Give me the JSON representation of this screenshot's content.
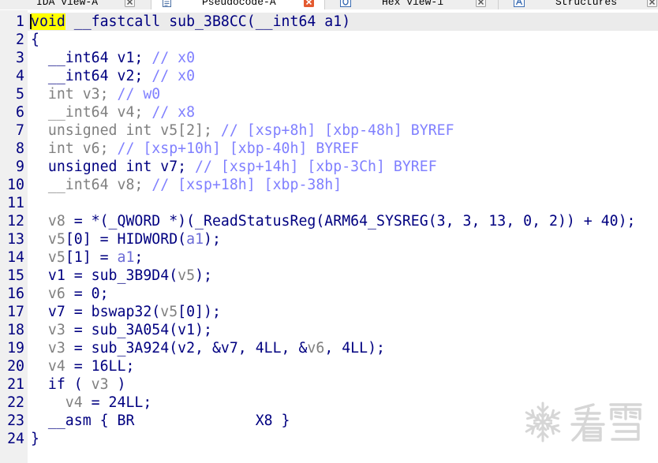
{
  "tabs": [
    {
      "label": "IDA View-A",
      "active": false
    },
    {
      "label": "Pseudocode-A",
      "active": true,
      "icon": "pseudocode-icon"
    },
    {
      "label": "Hex View-1",
      "active": false,
      "icon": "hex-view-icon"
    },
    {
      "label": "Structures",
      "active": false,
      "icon": "structures-icon"
    }
  ],
  "theme": {
    "close_active": "#e45a30"
  },
  "editor": {
    "colors": {
      "text": "#000080",
      "line_number": "#000080",
      "gutter_bg": "#f0f0f0",
      "current_line_bg": "#ebebeb"
    },
    "lines": [
      {
        "num": 1,
        "current": true,
        "tokens": [
          {
            "text": "void",
            "color": "#000080",
            "highlight": "#ffff00"
          },
          {
            "text": " __fastcall sub_3B8CC(__int64 a1)",
            "color": "#000080"
          }
        ]
      },
      {
        "num": 2,
        "tokens": [
          {
            "text": "{",
            "color": "#000080"
          }
        ]
      },
      {
        "num": 3,
        "tokens": [
          {
            "text": "  __int64 v1; ",
            "color": "#000080"
          },
          {
            "text": "// x0",
            "color": "#8080ff"
          }
        ]
      },
      {
        "num": 4,
        "tokens": [
          {
            "text": "  __int64 v2; ",
            "color": "#000080"
          },
          {
            "text": "// x0",
            "color": "#8080ff"
          }
        ]
      },
      {
        "num": 5,
        "tokens": [
          {
            "text": "  int v3; ",
            "color": "#808080"
          },
          {
            "text": "// w0",
            "color": "#8080ff"
          }
        ]
      },
      {
        "num": 6,
        "tokens": [
          {
            "text": "  __int64 v4; ",
            "color": "#808080"
          },
          {
            "text": "// x8",
            "color": "#8080ff"
          }
        ]
      },
      {
        "num": 7,
        "tokens": [
          {
            "text": "  unsigned int v5[2]; ",
            "color": "#808080"
          },
          {
            "text": "// [xsp+8h] [xbp-48h] BYREF",
            "color": "#8080ff"
          }
        ]
      },
      {
        "num": 8,
        "tokens": [
          {
            "text": "  int v6; ",
            "color": "#808080"
          },
          {
            "text": "// [xsp+10h] [xbp-40h] BYREF",
            "color": "#8080ff"
          }
        ]
      },
      {
        "num": 9,
        "tokens": [
          {
            "text": "  unsigned int v7; ",
            "color": "#000080"
          },
          {
            "text": "// [xsp+14h] [xbp-3Ch] BYREF",
            "color": "#8080ff"
          }
        ]
      },
      {
        "num": 10,
        "tokens": [
          {
            "text": "  __int64 v8; ",
            "color": "#808080"
          },
          {
            "text": "// [xsp+18h] [xbp-38h]",
            "color": "#8080ff"
          }
        ]
      },
      {
        "num": 11,
        "tokens": []
      },
      {
        "num": 12,
        "tokens": [
          {
            "text": "  v8",
            "color": "#808080"
          },
          {
            "text": " = *(_QWORD *)(_ReadStatusReg(ARM64_SYSREG(3, 3, 13, 0, 2)) + 40);",
            "color": "#000080"
          }
        ]
      },
      {
        "num": 13,
        "tokens": [
          {
            "text": "  v5",
            "color": "#808080"
          },
          {
            "text": "[0] = HIDWORD(",
            "color": "#000080"
          },
          {
            "text": "a1",
            "color": "#6b6bd6"
          },
          {
            "text": ");",
            "color": "#000080"
          }
        ]
      },
      {
        "num": 14,
        "tokens": [
          {
            "text": "  v5",
            "color": "#808080"
          },
          {
            "text": "[1] = ",
            "color": "#000080"
          },
          {
            "text": "a1",
            "color": "#6b6bd6"
          },
          {
            "text": ";",
            "color": "#000080"
          }
        ]
      },
      {
        "num": 15,
        "tokens": [
          {
            "text": "  v1 = sub_3B9D4(",
            "color": "#000080"
          },
          {
            "text": "v5",
            "color": "#808080"
          },
          {
            "text": ");",
            "color": "#000080"
          }
        ]
      },
      {
        "num": 16,
        "tokens": [
          {
            "text": "  v6",
            "color": "#808080"
          },
          {
            "text": " = 0;",
            "color": "#000080"
          }
        ]
      },
      {
        "num": 17,
        "tokens": [
          {
            "text": "  v7 = bswap32(",
            "color": "#000080"
          },
          {
            "text": "v5",
            "color": "#808080"
          },
          {
            "text": "[0]);",
            "color": "#000080"
          }
        ]
      },
      {
        "num": 18,
        "tokens": [
          {
            "text": "  v3",
            "color": "#808080"
          },
          {
            "text": " = sub_3A054(v1);",
            "color": "#000080"
          }
        ]
      },
      {
        "num": 19,
        "tokens": [
          {
            "text": "  v3",
            "color": "#808080"
          },
          {
            "text": " = sub_3A924(v2, &v7, 4LL, &",
            "color": "#000080"
          },
          {
            "text": "v6",
            "color": "#808080"
          },
          {
            "text": ", 4LL);",
            "color": "#000080"
          }
        ]
      },
      {
        "num": 20,
        "tokens": [
          {
            "text": "  v4",
            "color": "#808080"
          },
          {
            "text": " = 16LL;",
            "color": "#000080"
          }
        ]
      },
      {
        "num": 21,
        "tokens": [
          {
            "text": "  if ( ",
            "color": "#000080"
          },
          {
            "text": "v3",
            "color": "#808080"
          },
          {
            "text": " )",
            "color": "#000080"
          }
        ]
      },
      {
        "num": 22,
        "tokens": [
          {
            "text": "    v4",
            "color": "#808080"
          },
          {
            "text": " = 24LL;",
            "color": "#000080"
          }
        ]
      },
      {
        "num": 23,
        "tokens": [
          {
            "text": "  __asm { BR              X8 }",
            "color": "#000080"
          }
        ]
      },
      {
        "num": 24,
        "tokens": [
          {
            "text": "}",
            "color": "#000080"
          }
        ]
      }
    ]
  },
  "watermark": {
    "text": "看雪",
    "icon": "snowflake-logo-icon",
    "color": "#d6d6d6"
  }
}
